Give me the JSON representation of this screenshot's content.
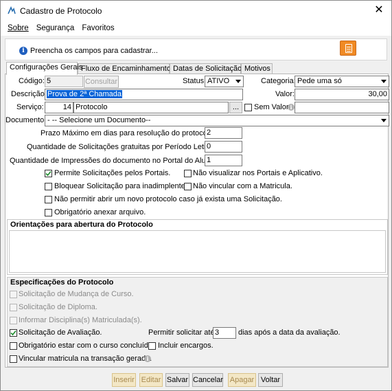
{
  "window": {
    "title": "Cadastro de Protocolo",
    "close_icon": "close-icon"
  },
  "menu": {
    "items": [
      "Sobre",
      "Segurança",
      "Favoritos"
    ]
  },
  "info": {
    "message": "Preencha os campos para cadastrar..."
  },
  "tabs": [
    "Configurações Gerais",
    "Fluxo de Encaminhamentos",
    "Datas de Solicitação",
    "Motivos"
  ],
  "form": {
    "codigo_label": "Código:",
    "codigo_value": "5",
    "consultar_label": "Consultar",
    "status_label": "Status:",
    "status_value": "ATIVO",
    "categoria_label": "Categoria:",
    "categoria_value": "Pede uma só",
    "descricao_label": "Descrição:",
    "descricao_value": "Prova de 2ª Chamada",
    "valor_label": "Valor:",
    "valor_value": "30,00",
    "servico_label": "Serviço:",
    "servico_code": "14",
    "servico_name": "Protocolo",
    "ellipsis_label": "...",
    "sem_valor_label": "Sem Valor",
    "documento_label": "Documento:",
    "documento_value": "- -- Selecione um Documento--",
    "prazo_label": "Prazo Máximo em dias para resolução do protocolo:",
    "prazo_value": "2",
    "qtd_solic_label": "Quantidade de Solicitações gratuitas por Período Letivo:",
    "qtd_solic_value": "0",
    "qtd_impr_label": "Quantidade de Impressões do documento no Portal do Aluno:",
    "qtd_impr_value": "1"
  },
  "options": {
    "permite_portais": "Permite Solicitações pelos Portais.",
    "nao_visualizar": "Não visualizar nos Portais e Aplicativo.",
    "bloquear": "Bloquear Solicitação para inadimplentes.",
    "nao_vincular": "Não vincular com a Matricula.",
    "nao_permitir": "Não permitir abrir um novo protocolo caso já exista uma Solicitação.",
    "obrigatorio_anexo": "Obrigatório anexar arquivo."
  },
  "orientacoes": {
    "title": "Orientações para abertura do Protocolo",
    "text": ""
  },
  "especificacoes": {
    "title": "Especificações do Protocolo",
    "mudanca_curso": "Solicitação de Mudança de Curso.",
    "diploma": "Solicitação de Diploma.",
    "informar_disciplina": "Informar Disciplina(s) Matriculada(s).",
    "avaliacao": "Solicitação de Avaliação.",
    "permitir_ate_label": "Permitir solicitar até:",
    "permitir_ate_value": "3",
    "dias_label": "dias após a data da avaliação.",
    "curso_concluido": "Obrigatório estar com o curso concluído.",
    "incluir_encargos": "Incluir encargos.",
    "vincular_matricula": "Vincular matricula na transação gerada."
  },
  "buttons": {
    "inserir": "Inserir",
    "editar": "Editar",
    "salvar": "Salvar",
    "cancelar": "Cancelar",
    "apagar": "Apagar",
    "voltar": "Voltar"
  },
  "colors": {
    "accent": "#f08a24",
    "selection": "#0a64d8",
    "info": "#1f5fbf"
  }
}
